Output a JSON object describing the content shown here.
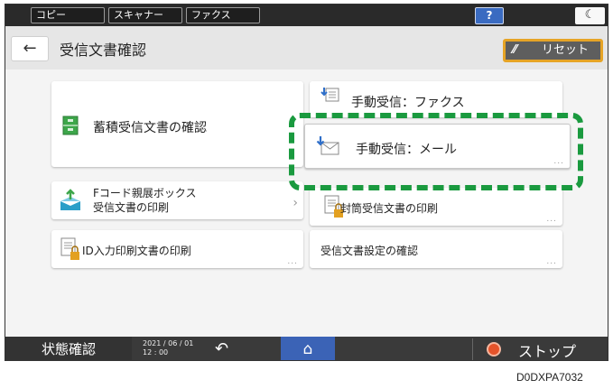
{
  "topbar": {
    "tabs": [
      "コピー",
      "スキャナー",
      "ファクス"
    ],
    "help_label": "?",
    "moon_label": "☾"
  },
  "header": {
    "back_label": "←",
    "title": "受信文書確認",
    "reset_label": "リセット",
    "reset_icon": "⁄⁄"
  },
  "tiles": {
    "stored": "蓄積受信文書の確認",
    "manual_fax": "手動受信：ファクス",
    "manual_mail": "手動受信：メール",
    "fcode_line1": "Fコード親展ボックス",
    "fcode_line2": "受信文書の印刷",
    "confidential": "封筒受信文書の印刷",
    "id_print": "ID入力印刷文書の印刷",
    "settings": "受信文書設定の確認",
    "more": "..."
  },
  "bottombar": {
    "status_label": "状態確認",
    "date": "2021 / 06 / 01",
    "time": "12 : 00",
    "back_icon": "↶",
    "home_icon": "⌂",
    "stop_label": "ストップ"
  },
  "doc_code": "D0DXPA7032",
  "colors": {
    "highlight": "#1a9a3f",
    "reset_border": "#e6a426",
    "home": "#3b63b6",
    "help": "#3a6bc1",
    "stop": "#e5532a"
  }
}
